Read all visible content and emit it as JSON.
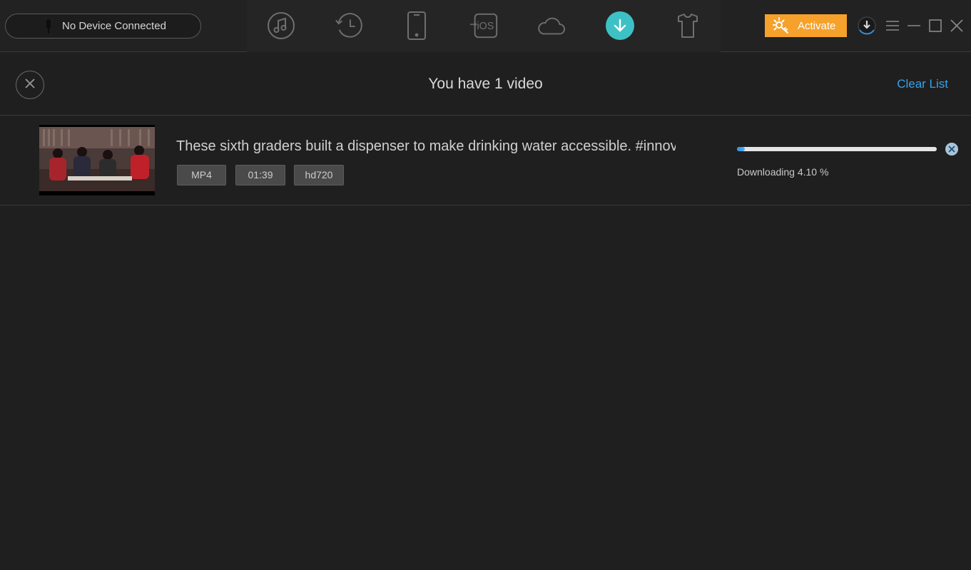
{
  "topbar": {
    "device_status": "No Device Connected",
    "nav": [
      {
        "id": "music",
        "icon": "music-icon"
      },
      {
        "id": "history",
        "icon": "history-icon"
      },
      {
        "id": "device",
        "icon": "phone-icon"
      },
      {
        "id": "to-ios",
        "icon": "to-ios-icon",
        "label": "iOS"
      },
      {
        "id": "cloud",
        "icon": "cloud-icon"
      },
      {
        "id": "download",
        "icon": "download-icon",
        "active": true
      },
      {
        "id": "tshirt",
        "icon": "tshirt-icon"
      }
    ],
    "activate_label": "Activate",
    "accent_color": "#3ec1c4",
    "activate_color": "#f6a12b"
  },
  "header": {
    "title": "You have 1 video",
    "clear_label": "Clear List"
  },
  "videos": [
    {
      "title": "These sixth graders built a dispenser to make drinking water accessible. #innov...",
      "format": "MP4",
      "duration": "01:39",
      "resolution": "hd720",
      "progress": 4.1,
      "status": "Downloading 4.10 %"
    }
  ],
  "colors": {
    "link": "#35a3e8",
    "progress": "#2c8fe0"
  }
}
